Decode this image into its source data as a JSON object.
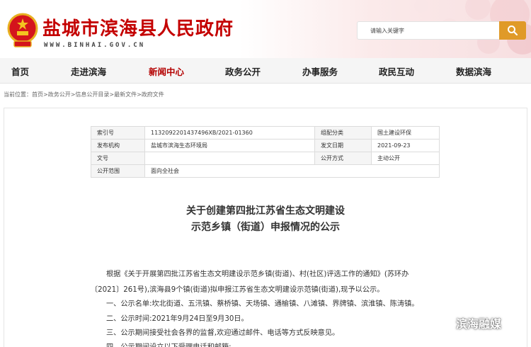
{
  "header": {
    "site_title": "盐城市滨海县人民政府",
    "site_url": "WWW.BINHAI.GOV.CN",
    "search_placeholder": "请输入关键字"
  },
  "nav": {
    "items": [
      "首页",
      "走进滨海",
      "新闻中心",
      "政务公开",
      "办事服务",
      "政民互动",
      "数据滨海"
    ],
    "active": "新闻中心"
  },
  "breadcrumb": "当前位置：首页>政务公开>信息公开目录>最新文件>政府文件",
  "info": {
    "index_label": "索引号",
    "index_value": "1132092201437496XB/2021-01360",
    "category_label": "组配分类",
    "category_value": "国土建设环保",
    "publisher_label": "发布机构",
    "publisher_value": "盐城市滨海生态环境局",
    "date_label": "发文日期",
    "date_value": "2021-09-23",
    "docno_label": "文号",
    "docno_value": "",
    "mode_label": "公开方式",
    "mode_value": "主动公开",
    "scope_label": "公开范围",
    "scope_value": "面向全社会"
  },
  "article": {
    "title_line1": "关于创建第四批江苏省生态文明建设",
    "title_line2": "示范乡镇（街道）申报情况的公示",
    "p1_line1": "根据《关于开展第四批江苏省生态文明建设示范乡镇(街道)、村(社区)评选工作的通知》(苏环办",
    "p1_line2": "〔2021〕261号),滨海县9个镇(街道)拟申报江苏省生态文明建设示范镇(街道),现予以公示。",
    "item1": "一、公示名单:坎北街道、五汛镇、蔡桥镇、天场镇、通榆镇、八滩镇、界牌镇、滨淮镇、陈涛镇。",
    "item2": "二、公示时间:2021年9月24日至9月30日。",
    "item3": "三、公示期间接受社会各界的监督,欢迎通过邮件、电话等方式反映意见。",
    "item4": "四、公示期间设立以下受理电话和邮箱:"
  },
  "watermark": "滨海融媒",
  "colors": {
    "brand_red": "#c40000",
    "nav_active": "#b40000",
    "search_button": "#e09a28"
  },
  "icons": [
    "national-emblem-icon",
    "search-icon",
    "wechat-icon"
  ]
}
